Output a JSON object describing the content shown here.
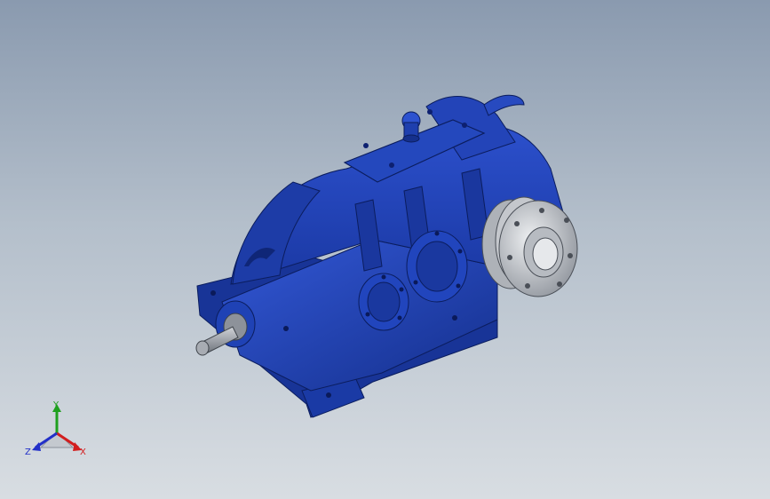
{
  "viewport": {
    "background_top": "#8a9aaf",
    "background_bottom": "#d8dde2"
  },
  "model": {
    "part_color": "#1c3fae",
    "shaft_color": "#9a9ea6",
    "flange_color": "#c9ccd1"
  },
  "triad": {
    "x_label": "X",
    "y_label": "Y",
    "z_label": "Z",
    "x_color": "#d21e1e",
    "y_color": "#1fa01f",
    "z_color": "#2230c8"
  }
}
